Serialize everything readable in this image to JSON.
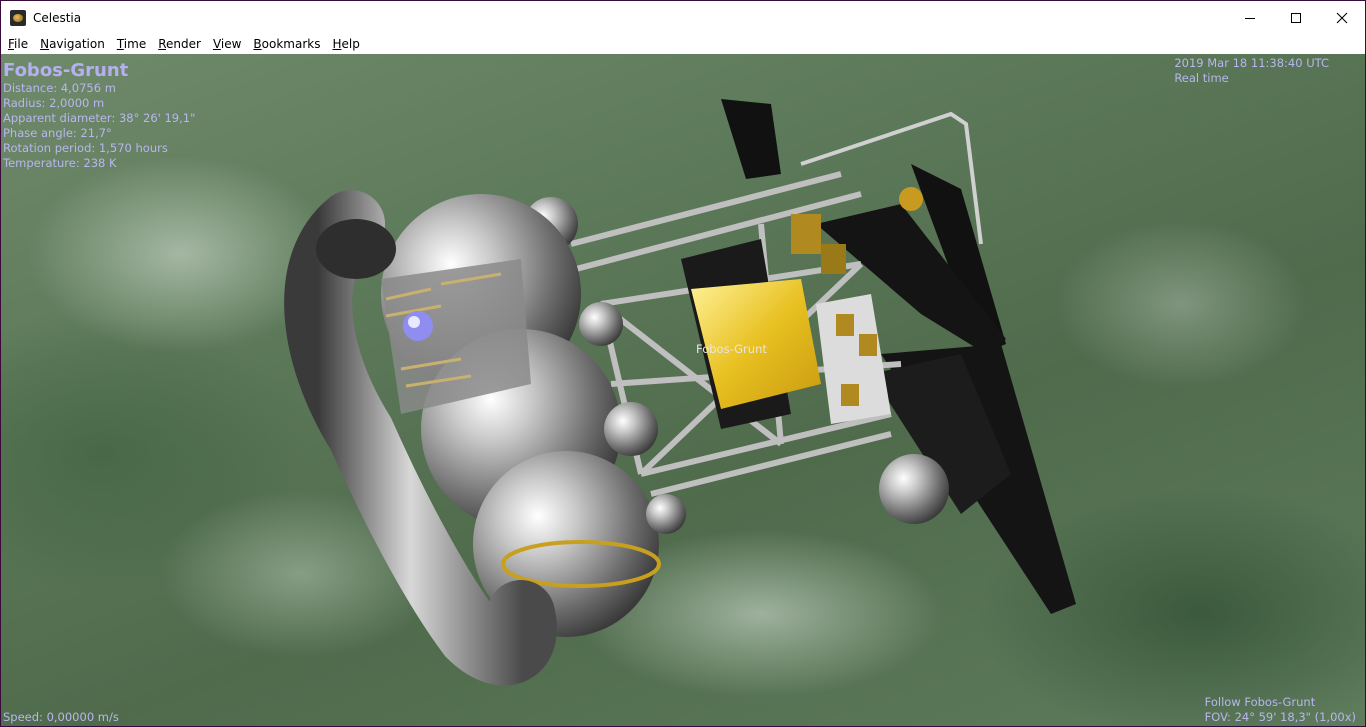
{
  "window": {
    "title": "Celestia"
  },
  "menu": [
    {
      "first": "F",
      "rest": "ile"
    },
    {
      "first": "N",
      "rest": "avigation"
    },
    {
      "first": "T",
      "rest": "ime"
    },
    {
      "first": "R",
      "rest": "ender"
    },
    {
      "first": "V",
      "rest": "iew"
    },
    {
      "first": "B",
      "rest": "ookmarks"
    },
    {
      "first": "H",
      "rest": "elp"
    }
  ],
  "info": {
    "name": "Fobos-Grunt",
    "distance": "Distance: 4,0756 m",
    "radius": "Radius: 2,0000 m",
    "apparent_diameter": "Apparent diameter: 38° 26' 19,1\"",
    "phase_angle": "Phase angle: 21,7°",
    "rotation_period": "Rotation period: 1,570 hours",
    "temperature": "Temperature: 238 K"
  },
  "time": {
    "datetime": "2019 Mar 18 11:38:40 UTC",
    "mode": "Real time"
  },
  "speed": "Speed: 0,00000 m/s",
  "camera": {
    "follow": "Follow Fobos-Grunt",
    "fov": "FOV: 24° 59' 18,3\" (1,00x)"
  },
  "object_label": "Fobos-Grunt",
  "icons": {
    "app": "celestia-icon",
    "minimize": "minimize-icon",
    "maximize": "maximize-icon",
    "close": "close-icon"
  }
}
